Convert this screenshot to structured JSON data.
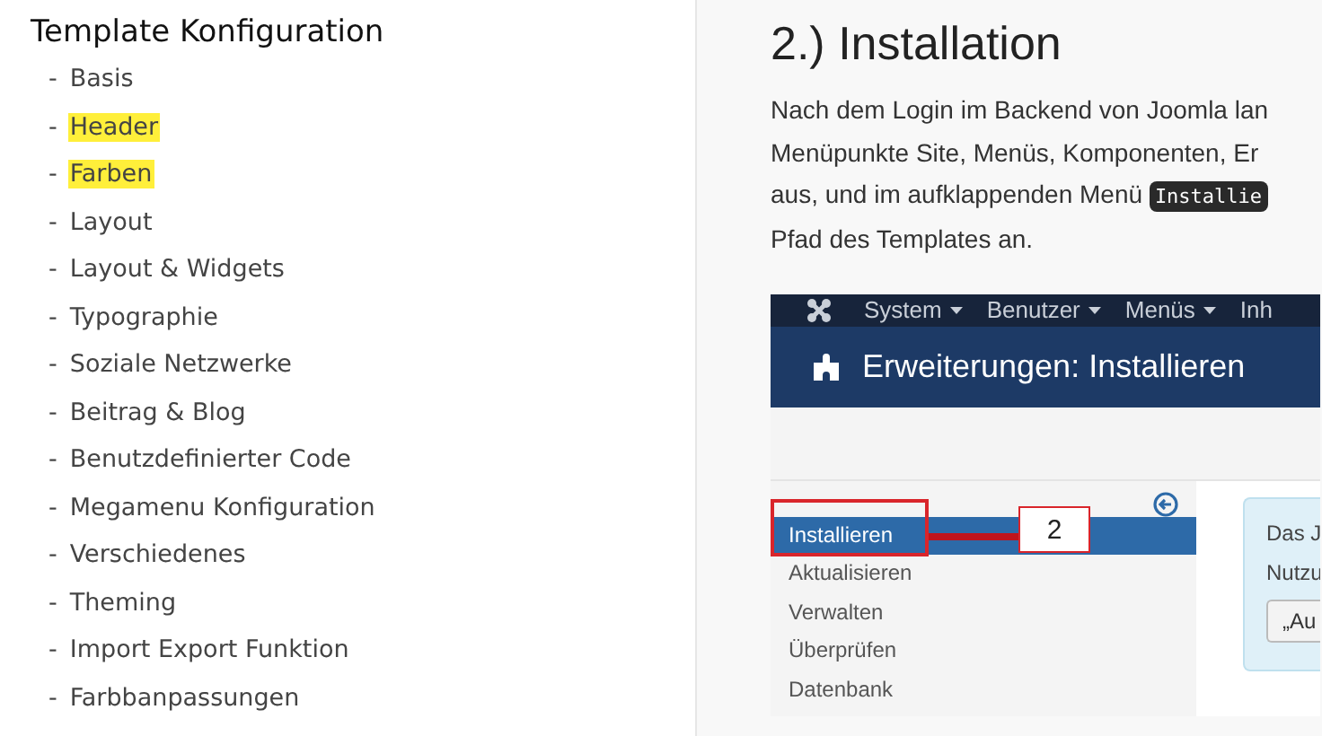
{
  "sidebar": {
    "title": "Template Konfiguration",
    "items": [
      {
        "dash": "-",
        "label": "Basis",
        "highlighted": false
      },
      {
        "dash": "-",
        "label": "Header",
        "highlighted": true
      },
      {
        "dash": "-",
        "label": "Farben",
        "highlighted": true
      },
      {
        "dash": "-",
        "label": "Layout",
        "highlighted": false
      },
      {
        "dash": "-",
        "label": "Layout & Widgets",
        "highlighted": false
      },
      {
        "dash": "-",
        "label": "Typographie",
        "highlighted": false
      },
      {
        "dash": "-",
        "label": "Soziale Netzwerke",
        "highlighted": false
      },
      {
        "dash": "-",
        "label": "Beitrag & Blog",
        "highlighted": false
      },
      {
        "dash": "-",
        "label": "Benutzdefinierter Code",
        "highlighted": false
      },
      {
        "dash": "-",
        "label": "Megamenu Konfiguration",
        "highlighted": false
      },
      {
        "dash": "-",
        "label": "Verschiedenes",
        "highlighted": false
      },
      {
        "dash": "-",
        "label": "Theming",
        "highlighted": false
      },
      {
        "dash": "-",
        "label": "Import Export Funktion",
        "highlighted": false
      },
      {
        "dash": "-",
        "label": "Farbbanpassungen",
        "highlighted": false
      }
    ]
  },
  "article": {
    "heading": "2.) Installation",
    "paragraph": {
      "lines": [
        "Nach dem Login im Backend von Joomla lan",
        "Menüpunkte Site, Menüs, Komponenten, Er",
        "aus, und im aufklappenden Menü"
      ],
      "code": "Installie",
      "after": "Pfad des Templates an."
    },
    "screenshot": {
      "menu": [
        {
          "label": "System",
          "caret": true
        },
        {
          "label": "Benutzer",
          "caret": true
        },
        {
          "label": "Menüs",
          "caret": true
        },
        {
          "label": "Inh",
          "caret": false
        }
      ],
      "title": "Erweiterungen: Installieren",
      "nav": [
        {
          "label": "Installieren",
          "selected": true
        },
        {
          "label": "Aktualisieren",
          "selected": false
        },
        {
          "label": "Verwalten",
          "selected": false
        },
        {
          "label": "Überprüfen",
          "selected": false
        },
        {
          "label": "Datenbank",
          "selected": false
        }
      ],
      "callout": "2",
      "info": {
        "lines": [
          "Das J",
          "Nutzu"
        ],
        "button": "„Au"
      }
    }
  }
}
